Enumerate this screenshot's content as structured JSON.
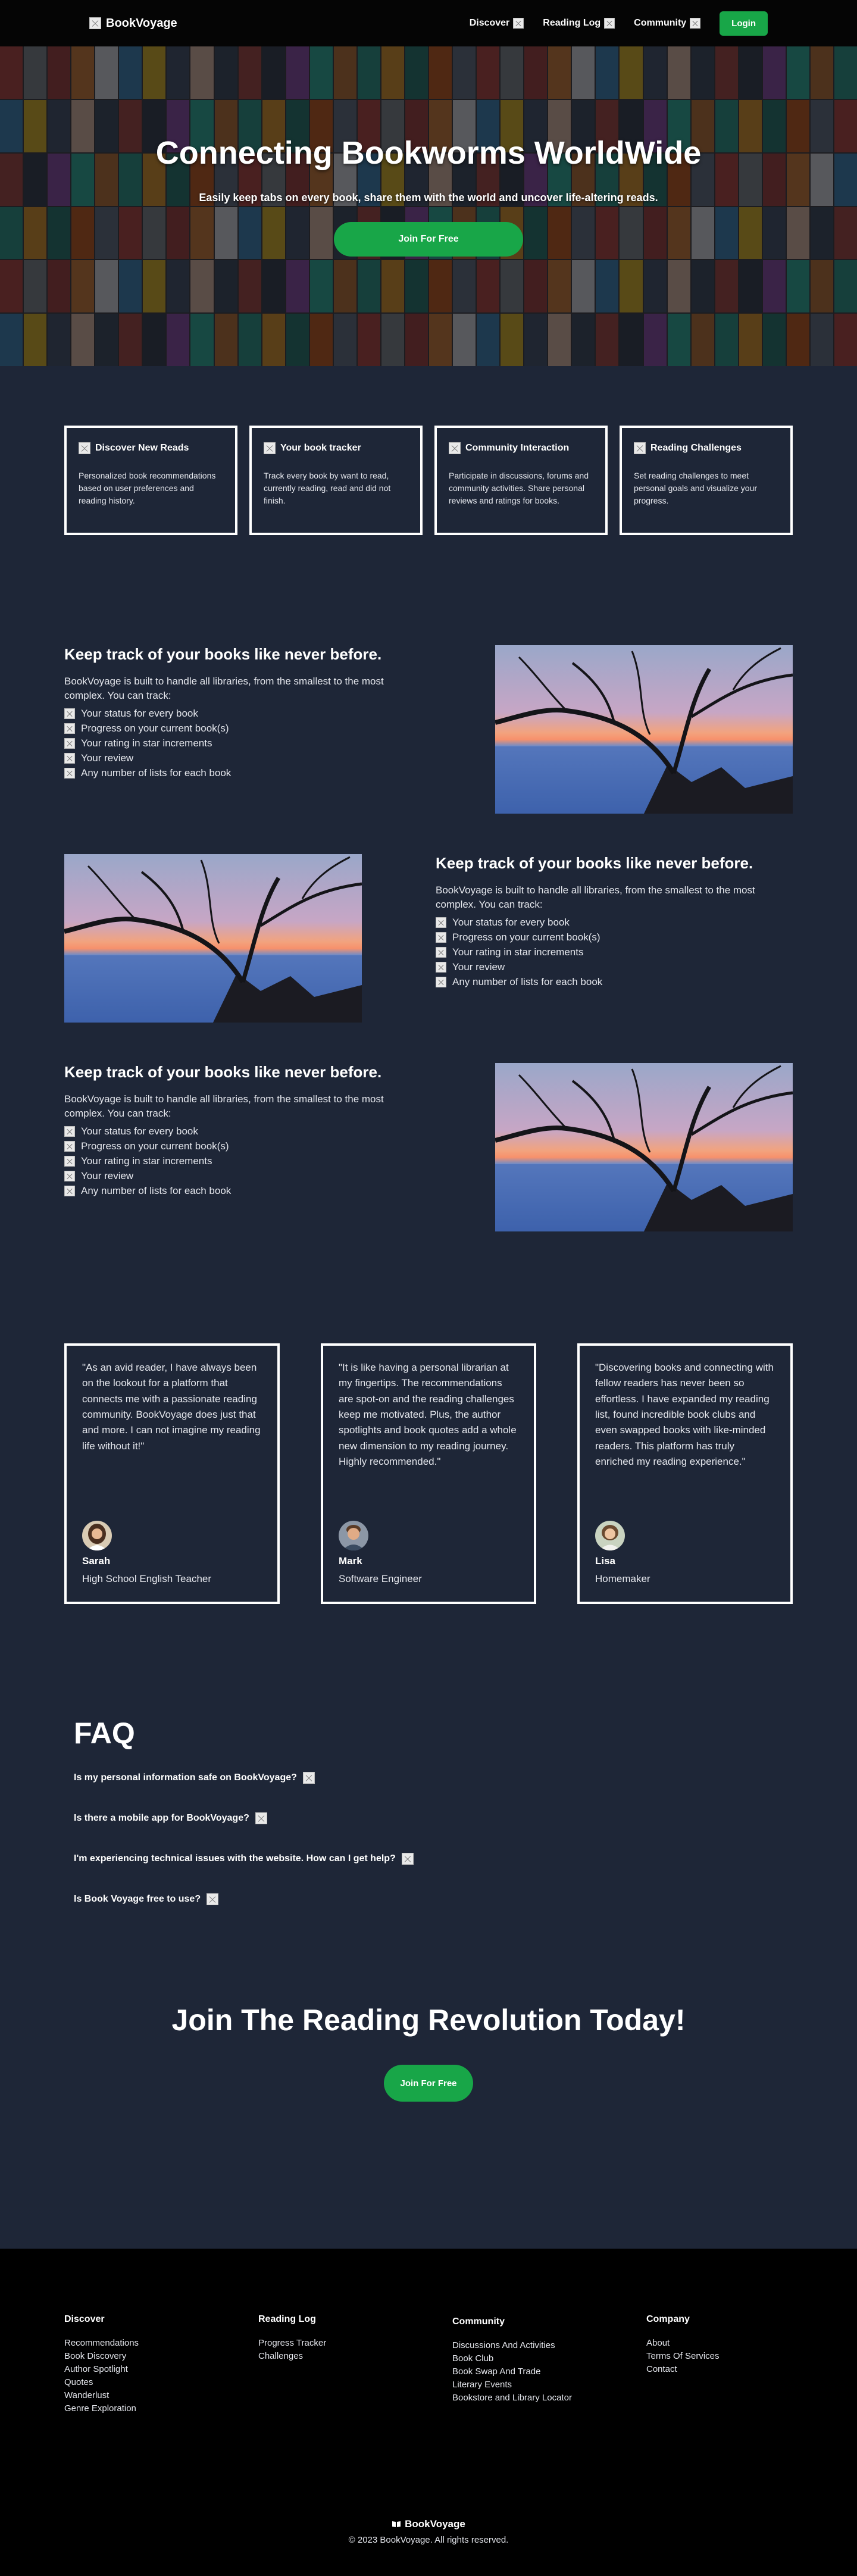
{
  "nav": {
    "brand": "BookVoyage",
    "brand_icon": "book-icon",
    "links": [
      {
        "label": "Discover",
        "icon": "chevron-down-icon"
      },
      {
        "label": "Reading Log",
        "icon": "chevron-down-icon"
      },
      {
        "label": "Community",
        "icon": "chevron-down-icon"
      }
    ],
    "login": "Login"
  },
  "hero": {
    "title": "Connecting Bookworms WorldWide",
    "subtitle": "Easily keep tabs on every book, share them with the world and uncover life-altering reads.",
    "cta": "Join For Free"
  },
  "features": [
    {
      "title": "Discover New Reads",
      "text": "Personalized book recommendations based on user preferences and reading history."
    },
    {
      "title": "Your book tracker",
      "text": "Track every book by want to read, currently reading, read and did not finish."
    },
    {
      "title": "Community Interaction",
      "text": "Participate in discussions, forums and community activities. Share personal reviews and ratings for books."
    },
    {
      "title": "Reading Challenges",
      "text": "Set reading challenges to meet personal goals and visualize your progress."
    }
  ],
  "track": [
    {
      "title": "Keep track of your books like never before.",
      "intro": "BookVoyage is built to handle all libraries, from the smallest to the most complex. You can track:",
      "items": [
        "Your status for every book",
        "Progress on your current book(s)",
        "Your rating in star increments",
        "Your review",
        "Any number of lists for each book"
      ]
    },
    {
      "title": "Keep track of your books like never before.",
      "intro": "BookVoyage is built to handle all libraries, from the smallest to the most complex. You can track:",
      "items": [
        "Your status for every book",
        "Progress on your current book(s)",
        "Your rating in star increments",
        "Your review",
        "Any number of lists for each book"
      ]
    },
    {
      "title": "Keep track of your books like never before.",
      "intro": "BookVoyage is built to handle all libraries, from the smallest to the most complex. You can track:",
      "items": [
        "Your status for every book",
        "Progress on your current book(s)",
        "Your rating in star increments",
        "Your review",
        "Any number of lists for each book"
      ]
    }
  ],
  "testimonials": [
    {
      "quote": "\"As an avid reader, I have always been on the lookout for a platform that connects me with a passionate reading community. BookVoyage does just that and more. I can not imagine my reading life without it!\"",
      "name": "Sarah",
      "role": "High School English Teacher"
    },
    {
      "quote": "\"It is like having a personal librarian at my fingertips. The recommendations are spot-on and the reading challenges keep me motivated. Plus, the author spotlights and book quotes add a whole new dimension to my reading journey. Highly recommended.\"",
      "name": "Mark",
      "role": "Software Engineer"
    },
    {
      "quote": "\"Discovering books and connecting with fellow readers has never been so effortless. I have expanded my reading list, found incredible book clubs and even swapped books with like-minded readers. This platform has truly enriched my reading experience.\"",
      "name": "Lisa",
      "role": "Homemaker"
    }
  ],
  "faq": {
    "title": "FAQ",
    "questions": [
      "Is my personal information safe on BookVoyage?",
      "Is there a mobile app for BookVoyage?",
      "I'm experiencing technical issues with the website. How can I get help?",
      "Is Book Voyage free to use?"
    ]
  },
  "join": {
    "title": "Join The Reading Revolution Today!",
    "cta": "Join For Free"
  },
  "footer": {
    "columns": [
      {
        "title": "Discover",
        "links": [
          "Recommendations",
          "Book Discovery",
          "Author Spotlight",
          "Quotes",
          "Wanderlust",
          "Genre Exploration"
        ]
      },
      {
        "title": "Reading Log",
        "links": [
          "Progress Tracker",
          "Challenges"
        ]
      },
      {
        "title": "Community",
        "links": [
          "Discussions And Activities",
          "Book Club",
          "Book Swap And Trade",
          "Literary Events",
          "Bookstore and Library Locator"
        ]
      },
      {
        "title": "Company",
        "links": [
          "About",
          "Terms Of Services",
          "Contact"
        ]
      }
    ],
    "brand": "BookVoyage",
    "copyright": "© 2023 BookVoyage. All rights reserved."
  },
  "colors": {
    "background": "#1e2637",
    "nav": "#050505",
    "accent": "#18a648",
    "footer": "#000000"
  }
}
